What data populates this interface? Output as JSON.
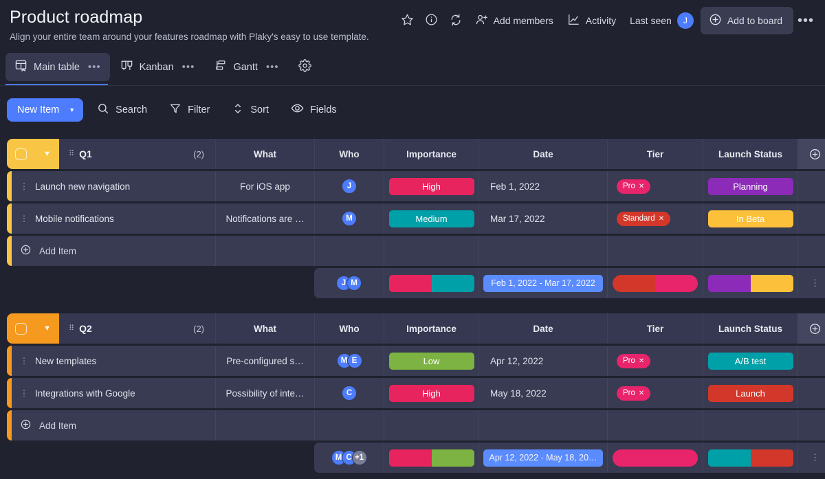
{
  "header": {
    "title": "Product roadmap",
    "subtitle": "Align your entire team around your features roadmap with Plaky's easy to use template.",
    "actions": {
      "star": "star-icon",
      "info": "info-icon",
      "refresh": "refresh-icon",
      "add_members": "Add members",
      "activity": "Activity",
      "last_seen": "Last seen",
      "last_seen_avatar": "J",
      "add_to_board": "Add to board",
      "more": "•••"
    }
  },
  "tabs": [
    {
      "label": "Main table",
      "active": true,
      "has_menu": true
    },
    {
      "label": "Kanban",
      "active": false,
      "has_menu": true
    },
    {
      "label": "Gantt",
      "active": false,
      "has_menu": true
    }
  ],
  "toolbar": {
    "new_item": "New Item",
    "search": "Search",
    "filter": "Filter",
    "sort": "Sort",
    "fields": "Fields"
  },
  "columns": [
    "What",
    "Who",
    "Importance",
    "Date",
    "Tier",
    "Launch Status"
  ],
  "add_item_label": "Add Item",
  "colors": {
    "accent_blue": "#4D7CFE",
    "q1_yellow": "#F8C644",
    "q2_orange": "#F59A1E",
    "high": "#E8245F",
    "medium": "#00A0A8",
    "low": "#7CB342",
    "pro": "#E8246B",
    "standard": "#D3372A",
    "planning": "#8B2BB8",
    "in_beta": "#FCC03A",
    "ab_test": "#00A0A8",
    "launch": "#D3372A"
  },
  "groups": [
    {
      "name": "Q1",
      "count": "(2)",
      "color": "#F8C644",
      "items": [
        {
          "title": "Launch new navigation",
          "what": "For iOS app",
          "who": [
            {
              "initial": "J",
              "color": "#4D7CFE"
            }
          ],
          "importance": {
            "label": "High",
            "color": "#E8245F"
          },
          "date": "Feb 1, 2022",
          "tier": {
            "label": "Pro",
            "color": "#E8246B"
          },
          "status": {
            "label": "Planning",
            "color": "#8B2BB8"
          }
        },
        {
          "title": "Mobile notifications",
          "what": "Notifications are …",
          "who": [
            {
              "initial": "M",
              "color": "#4D7CFE"
            }
          ],
          "importance": {
            "label": "Medium",
            "color": "#00A0A8"
          },
          "date": "Mar 17, 2022",
          "tier": {
            "label": "Standard",
            "color": "#D3372A"
          },
          "status": {
            "label": "In Beta",
            "color": "#FCC03A"
          }
        }
      ],
      "summary": {
        "avatars": [
          {
            "initial": "J",
            "color": "#4D7CFE"
          },
          {
            "initial": "M",
            "color": "#4D7CFE"
          }
        ],
        "importance_bar": [
          {
            "color": "#E8245F",
            "pct": 50
          },
          {
            "color": "#00A0A8",
            "pct": 50
          }
        ],
        "date_range": "Feb 1, 2022 - Mar 17, 2022",
        "tier_bar": [
          {
            "color": "#D3372A",
            "pct": 50
          },
          {
            "color": "#E8246B",
            "pct": 50
          }
        ],
        "status_bar": [
          {
            "color": "#8B2BB8",
            "pct": 50
          },
          {
            "color": "#FCC03A",
            "pct": 50
          }
        ]
      }
    },
    {
      "name": "Q2",
      "count": "(2)",
      "color": "#F59A1E",
      "items": [
        {
          "title": "New templates",
          "what": "Pre-configured s…",
          "who": [
            {
              "initial": "M",
              "color": "#4D7CFE"
            },
            {
              "initial": "E",
              "color": "#4D7CFE"
            }
          ],
          "importance": {
            "label": "Low",
            "color": "#7CB342"
          },
          "date": "Apr 12, 2022",
          "tier": {
            "label": "Pro",
            "color": "#E8246B"
          },
          "status": {
            "label": "A/B test",
            "color": "#00A0A8"
          }
        },
        {
          "title": "Integrations with Google",
          "what": "Possibility of inte…",
          "who": [
            {
              "initial": "C",
              "color": "#4D7CFE"
            }
          ],
          "importance": {
            "label": "High",
            "color": "#E8245F"
          },
          "date": "May 18, 2022",
          "tier": {
            "label": "Pro",
            "color": "#E8246B"
          },
          "status": {
            "label": "Launch",
            "color": "#D3372A"
          }
        }
      ],
      "summary": {
        "avatars": [
          {
            "initial": "M",
            "color": "#4D7CFE"
          },
          {
            "initial": "C",
            "color": "#4D7CFE"
          },
          {
            "initial": "+1",
            "color": "#7A7E96"
          }
        ],
        "importance_bar": [
          {
            "color": "#E8245F",
            "pct": 50
          },
          {
            "color": "#7CB342",
            "pct": 50
          }
        ],
        "date_range": "Apr 12, 2022 - May 18, 20…",
        "tier_bar": [
          {
            "color": "#E8246B",
            "pct": 100
          }
        ],
        "status_bar": [
          {
            "color": "#00A0A8",
            "pct": 50
          },
          {
            "color": "#D3372A",
            "pct": 50
          }
        ]
      }
    }
  ]
}
